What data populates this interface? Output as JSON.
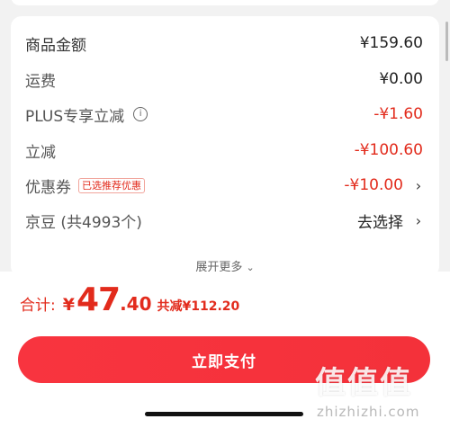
{
  "rows": [
    {
      "label": "商品金额",
      "value": "¥159.60"
    },
    {
      "label": "运费",
      "value": "¥0.00"
    },
    {
      "label": "PLUS专享立减",
      "value": "-¥1.60"
    },
    {
      "label": "立减",
      "value": "-¥100.60"
    },
    {
      "label": "优惠券",
      "tag": "已选推荐优惠",
      "value": "-¥10.00"
    },
    {
      "label": "京豆 (共4993个)",
      "value": "去选择"
    }
  ],
  "more_label": "展开更多",
  "total": {
    "label": "合计:",
    "currency": "¥",
    "integer": "47",
    "decimal": ".40",
    "saved": "共减¥112.20"
  },
  "pay_button": "立即支付",
  "watermark": {
    "glyphs": "值值值",
    "text": "zhizhizhi.com"
  },
  "colors": {
    "accent": "#e22b1c",
    "button": "#f4313a"
  }
}
